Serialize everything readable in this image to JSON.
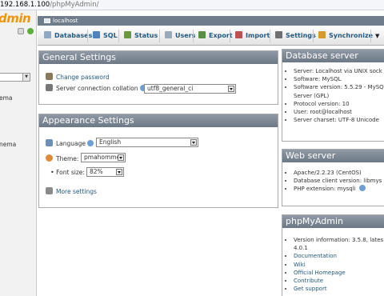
{
  "address_bar": {
    "host": "192.168.1.100",
    "path": "/phpMyAdmin/"
  },
  "logo_fragment": "dmin",
  "nav_fragments": [
    "ema",
    "nema"
  ],
  "server_bar": {
    "label": "localhost"
  },
  "tabs": [
    {
      "label": "Databases",
      "color": "#8fa8c4"
    },
    {
      "label": "SQL",
      "color": "#4f81bd"
    },
    {
      "label": "Status",
      "color": "#6b9a3e"
    },
    {
      "label": "Users",
      "color": "#9aa9b8"
    },
    {
      "label": "Export",
      "color": "#5a8f45"
    },
    {
      "label": "Import",
      "color": "#c0504d"
    },
    {
      "label": "Settings",
      "color": "#707070"
    },
    {
      "label": "Synchronize",
      "color": "#d69a2a"
    }
  ],
  "general_settings": {
    "title": "General Settings",
    "change_password": "Change password",
    "collation_label": "Server connection collation",
    "collation_value": "utf8_general_ci"
  },
  "appearance_settings": {
    "title": "Appearance Settings",
    "language_label": "Language",
    "language_value": "English",
    "theme_label": "Theme:",
    "theme_value": "pmahomme",
    "font_size_label": "Font size:",
    "font_size_value": "82%",
    "more_settings": "More settings"
  },
  "database_server": {
    "title": "Database server",
    "items": [
      "Server: Localhost via UNIX sock",
      "Software: MySQL",
      "Software version: 5.5.29 - MySQ Server (GPL)",
      "Protocol version: 10",
      "User: root@localhost",
      "Server charset: UTF-8 Unicode"
    ]
  },
  "web_server": {
    "title": "Web server",
    "items": [
      "Apache/2.2.23 (CentOS)",
      "Database client version: libmys",
      "PHP extension: mysqli"
    ]
  },
  "phpmyadmin": {
    "title": "phpMyAdmin",
    "items": [
      "Version information: 3.5.8, lates 4.0.1",
      "Documentation",
      "Wiki",
      "Official Homepage",
      "Contribute",
      "Get support"
    ]
  }
}
